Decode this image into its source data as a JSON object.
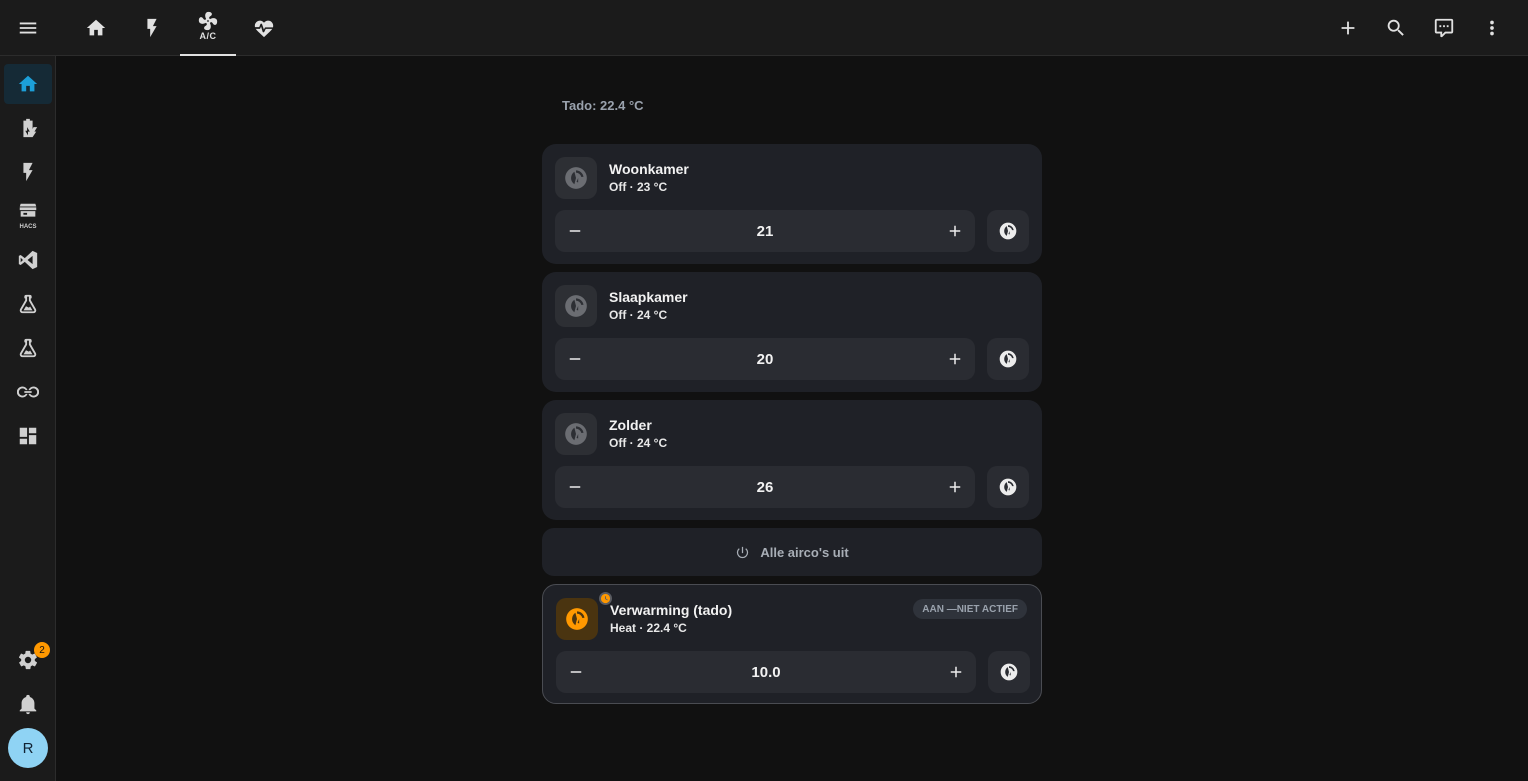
{
  "header": {
    "tabs": [
      {
        "name": "home",
        "label": ""
      },
      {
        "name": "energy",
        "label": ""
      },
      {
        "name": "ac",
        "label": "A/C"
      },
      {
        "name": "health",
        "label": ""
      }
    ],
    "actions": [
      "add-icon",
      "search-icon",
      "assist-icon",
      "more-icon"
    ]
  },
  "sidebar": {
    "items": [
      "home-icon",
      "battery-charging-icon",
      "lightning-icon",
      "hacs-icon",
      "vscode-icon",
      "flask-icon",
      "flask-icon",
      "integration-icon",
      "dashboard-icon"
    ],
    "hacs_label": "HACS",
    "settings_badge": "2",
    "avatar_initial": "R"
  },
  "main": {
    "heading": "Tado: 22.4 °C",
    "cards": [
      {
        "title": "Woonkamer",
        "state": "Off · 23 °C",
        "setpoint": "21"
      },
      {
        "title": "Slaapkamer",
        "state": "Off · 24 °C",
        "setpoint": "20"
      },
      {
        "title": "Zolder",
        "state": "Off · 24 °C",
        "setpoint": "26"
      }
    ],
    "all_off_label": "Alle airco's uit",
    "heating": {
      "title": "Verwarming (tado)",
      "state": "Heat · 22.4 °C",
      "chip": "AAN —NIET ACTIEF",
      "setpoint": "10.0"
    }
  },
  "colors": {
    "accent": "#1c9fd8",
    "heat": "#ff9800",
    "background": "#111111",
    "card": "#1f2127"
  }
}
